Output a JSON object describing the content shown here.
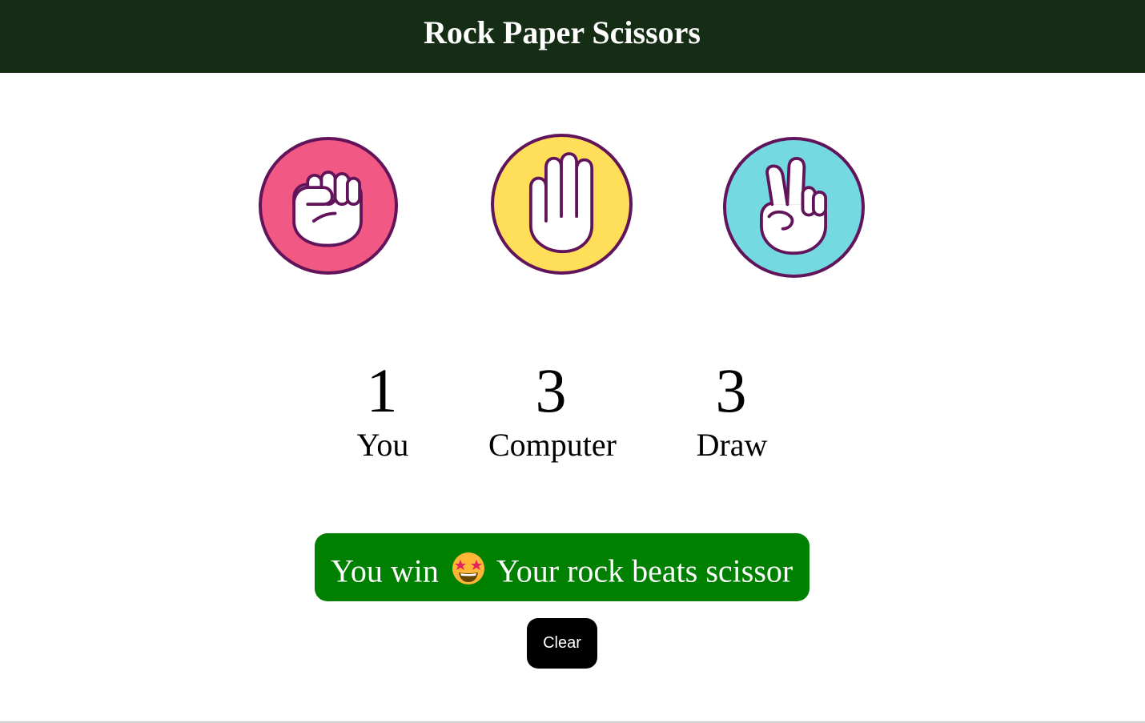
{
  "header": {
    "title": "Rock Paper Scissors"
  },
  "choices": [
    {
      "name": "rock",
      "icon": "fist-icon",
      "color": "#f15883"
    },
    {
      "name": "paper",
      "icon": "open-hand-icon",
      "color": "#ffde59"
    },
    {
      "name": "scissors",
      "icon": "peace-hand-icon",
      "color": "#74d9e1"
    }
  ],
  "scoreboard": {
    "you": {
      "score": "1",
      "label": "You"
    },
    "computer": {
      "score": "3",
      "label": "Computer"
    },
    "draw": {
      "score": "3",
      "label": "Draw"
    }
  },
  "result": {
    "prefix": "You win",
    "emoji": "star-struck-emoji",
    "message": "Your rock beats scissor",
    "color": "#008000"
  },
  "clear_button": {
    "label": "Clear"
  },
  "colors": {
    "header_bg": "#142d14",
    "outline": "#62145a"
  }
}
